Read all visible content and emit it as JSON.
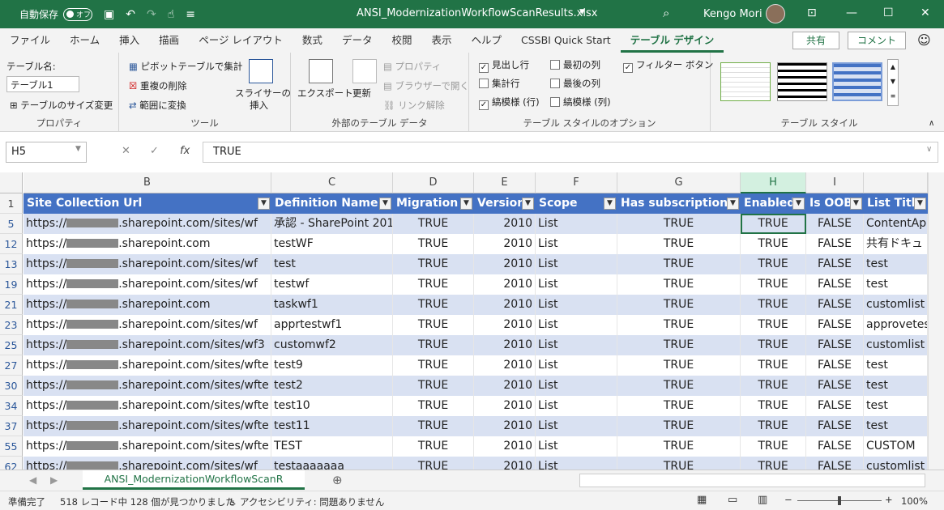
{
  "titlebar": {
    "autosave": "自動保存",
    "toggle": "オフ",
    "filename": "ANSI_ModernizationWorkflowScanResults.xlsx",
    "user": "Kengo Mori"
  },
  "tabs": [
    "ファイル",
    "ホーム",
    "挿入",
    "描画",
    "ページ レイアウト",
    "数式",
    "データ",
    "校閲",
    "表示",
    "ヘルプ",
    "CSSBI Quick Start",
    "テーブル デザイン"
  ],
  "share": "共有",
  "comment": "コメント",
  "ribbon": {
    "props": {
      "label": "テーブル名:",
      "value": "テーブル1",
      "resize": "テーブルのサイズ変更",
      "group": "プロパティ"
    },
    "tools": {
      "pivot": "ピボットテーブルで集計",
      "dedupe": "重複の削除",
      "convert": "範囲に変換",
      "slicer1": "スライサーの",
      "slicer2": "挿入",
      "group": "ツール"
    },
    "external": {
      "export": "エクスポート",
      "refresh": "更新",
      "props": "プロパティ",
      "browser": "ブラウザーで開く",
      "unlink": "リンク解除",
      "group": "外部のテーブル データ"
    },
    "options": {
      "header": "見出し行",
      "total": "集計行",
      "banded_rows": "縞模様 (行)",
      "first_col": "最初の列",
      "last_col": "最後の列",
      "banded_cols": "縞模様 (列)",
      "filter": "フィルター ボタン",
      "group": "テーブル スタイルのオプション"
    },
    "styles": {
      "group": "テーブル スタイル"
    }
  },
  "formula": {
    "namebox": "H5",
    "value": "TRUE"
  },
  "columns": [
    "B",
    "C",
    "D",
    "E",
    "F",
    "G",
    "H",
    "I"
  ],
  "headers": [
    "Site Collection Url",
    "Definition Name",
    "Migration t",
    "Version",
    "Scope",
    "Has subscriptions",
    "Enabled",
    "Is OOB",
    "List Title"
  ],
  "rows": [
    {
      "n": "5",
      "url_pre": "https://",
      "url_post": ".sharepoint.com/sites/wf",
      "def": "承認 - SharePoint 201",
      "mig": "TRUE",
      "ver": "2010",
      "scope": "List",
      "sub": "TRUE",
      "en": "TRUE",
      "oob": "FALSE",
      "lt": "ContentAp"
    },
    {
      "n": "12",
      "url_pre": "https://",
      "url_post": ".sharepoint.com",
      "def": "testWF",
      "mig": "TRUE",
      "ver": "2010",
      "scope": "List",
      "sub": "TRUE",
      "en": "TRUE",
      "oob": "FALSE",
      "lt": "共有ドキュ"
    },
    {
      "n": "13",
      "url_pre": "https://",
      "url_post": ".sharepoint.com/sites/wf",
      "def": "test",
      "mig": "TRUE",
      "ver": "2010",
      "scope": "List",
      "sub": "TRUE",
      "en": "TRUE",
      "oob": "FALSE",
      "lt": "test"
    },
    {
      "n": "19",
      "url_pre": "https://",
      "url_post": ".sharepoint.com/sites/wf",
      "def": "testwf",
      "mig": "TRUE",
      "ver": "2010",
      "scope": "List",
      "sub": "TRUE",
      "en": "TRUE",
      "oob": "FALSE",
      "lt": "test"
    },
    {
      "n": "21",
      "url_pre": "https://",
      "url_post": ".sharepoint.com",
      "def": "taskwf1",
      "mig": "TRUE",
      "ver": "2010",
      "scope": "List",
      "sub": "TRUE",
      "en": "TRUE",
      "oob": "FALSE",
      "lt": "customlist"
    },
    {
      "n": "23",
      "url_pre": "https://",
      "url_post": ".sharepoint.com/sites/wf",
      "def": "apprtestwf1",
      "mig": "TRUE",
      "ver": "2010",
      "scope": "List",
      "sub": "TRUE",
      "en": "TRUE",
      "oob": "FALSE",
      "lt": "approvetes"
    },
    {
      "n": "25",
      "url_pre": "https://",
      "url_post": ".sharepoint.com/sites/wf3",
      "def": "customwf2",
      "mig": "TRUE",
      "ver": "2010",
      "scope": "List",
      "sub": "TRUE",
      "en": "TRUE",
      "oob": "FALSE",
      "lt": "customlist"
    },
    {
      "n": "27",
      "url_pre": "https://",
      "url_post": ".sharepoint.com/sites/wfte",
      "def": "test9",
      "mig": "TRUE",
      "ver": "2010",
      "scope": "List",
      "sub": "TRUE",
      "en": "TRUE",
      "oob": "FALSE",
      "lt": "test"
    },
    {
      "n": "30",
      "url_pre": "https://",
      "url_post": ".sharepoint.com/sites/wfte",
      "def": "test2",
      "mig": "TRUE",
      "ver": "2010",
      "scope": "List",
      "sub": "TRUE",
      "en": "TRUE",
      "oob": "FALSE",
      "lt": "test"
    },
    {
      "n": "34",
      "url_pre": "https://",
      "url_post": ".sharepoint.com/sites/wfte",
      "def": "test10",
      "mig": "TRUE",
      "ver": "2010",
      "scope": "List",
      "sub": "TRUE",
      "en": "TRUE",
      "oob": "FALSE",
      "lt": "test"
    },
    {
      "n": "37",
      "url_pre": "https://",
      "url_post": ".sharepoint.com/sites/wfte",
      "def": "test11",
      "mig": "TRUE",
      "ver": "2010",
      "scope": "List",
      "sub": "TRUE",
      "en": "TRUE",
      "oob": "FALSE",
      "lt": "test"
    },
    {
      "n": "55",
      "url_pre": "https://",
      "url_post": ".sharepoint.com/sites/wfte",
      "def": "TEST",
      "mig": "TRUE",
      "ver": "2010",
      "scope": "List",
      "sub": "TRUE",
      "en": "TRUE",
      "oob": "FALSE",
      "lt": "CUSTOM"
    },
    {
      "n": "62",
      "url_pre": "https://",
      "url_post": ".sharepoint.com/sites/wf",
      "def": "testaaaaaaa",
      "mig": "TRUE",
      "ver": "2010",
      "scope": "List",
      "sub": "TRUE",
      "en": "TRUE",
      "oob": "FALSE",
      "lt": "customlist"
    }
  ],
  "sheet": {
    "tab": "ANSI_ModernizationWorkflowScanR"
  },
  "status": {
    "ready": "準備完了",
    "records": "518 レコード中 128 個が見つかりました",
    "access": "アクセシビリティ: 問題ありません",
    "zoom": "100%"
  },
  "colors": {
    "excel_green": "#217346",
    "table_header": "#4472c4",
    "band": "#d9e1f2"
  }
}
